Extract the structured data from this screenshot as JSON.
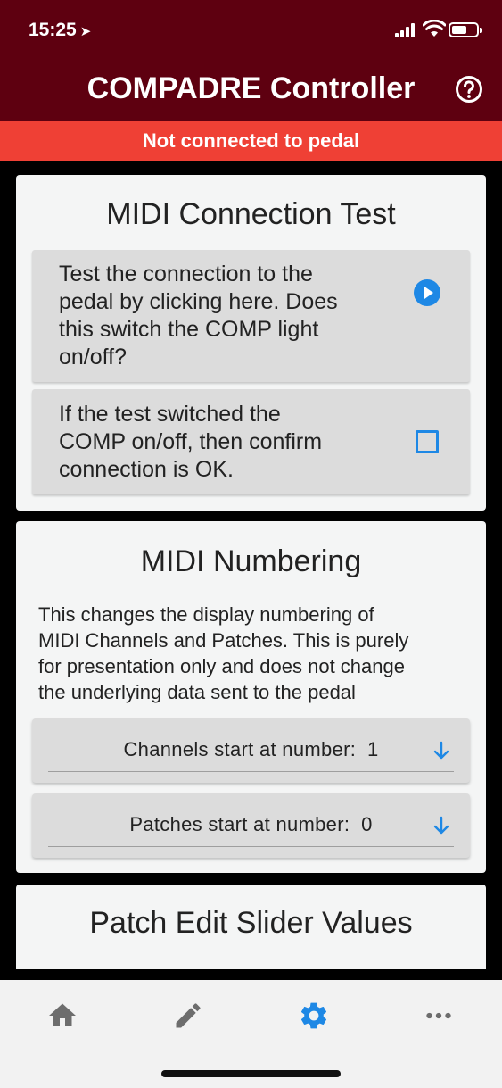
{
  "status_bar": {
    "time": "15:25",
    "location_glyph": "➤"
  },
  "header": {
    "title": "COMPADRE Controller",
    "help_icon": "help-circle-icon"
  },
  "banner": {
    "text": "Not connected to pedal"
  },
  "midi_connection_test": {
    "title": "MIDI Connection Test",
    "test_row": {
      "lines": [
        "Test the connection to the",
        "pedal by clicking here. Does",
        "this switch the COMP light",
        "on/off?"
      ]
    },
    "confirm_row": {
      "lines": [
        "If the test switched the",
        "COMP on/off, then confirm",
        "connection is OK."
      ],
      "checked": false
    }
  },
  "midi_numbering": {
    "title": "MIDI Numbering",
    "description_lines": [
      "This changes the display numbering of",
      "MIDI Channels and Patches. This is purely",
      "for presentation only and does not change",
      "the underlying data sent to the pedal"
    ],
    "channels_dropdown": {
      "label": "Channels start at number:",
      "value": "1"
    },
    "patches_dropdown": {
      "label": "Patches start at number:",
      "value": "0"
    }
  },
  "patch_edit_slider_values": {
    "title": "Patch Edit Slider Values"
  },
  "bottom_nav": {
    "items": [
      {
        "icon": "home-icon",
        "active": false
      },
      {
        "icon": "pencil-icon",
        "active": false
      },
      {
        "icon": "settings-gear-icon",
        "active": true
      },
      {
        "icon": "more-horizontal-icon",
        "active": false
      }
    ]
  },
  "colors": {
    "header_bg": "#5e0010",
    "banner_bg": "#ef4035",
    "accent": "#1e88e5",
    "nav_inactive": "#6d6d6d"
  }
}
